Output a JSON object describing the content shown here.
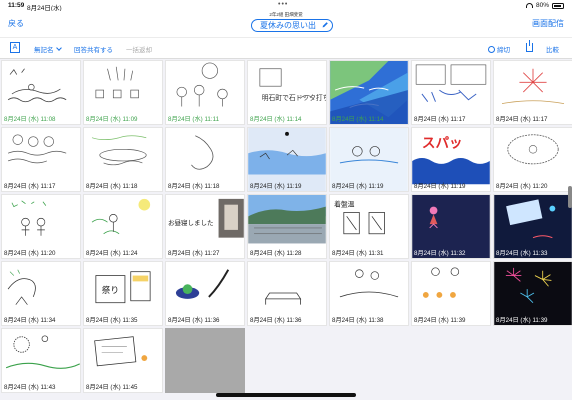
{
  "status": {
    "time": "11:59",
    "date": "8月24日(水)",
    "battery": "80%"
  },
  "nav": {
    "back_label": "戻る",
    "class_label": "2年2組 田畑斐覚",
    "title": "夏休みの思い出",
    "screen_share_label": "画面配信"
  },
  "toolbar": {
    "a_icon": "A",
    "anonymous_label": "無記名",
    "share_answers_label": "回答共有する",
    "bulk_return_label": "一括返却",
    "deadline_label": "締切",
    "compare_label": "比較"
  },
  "icons": {
    "pencil": "pencil-icon",
    "share": "share-icon",
    "clock": "clock-icon",
    "wifi": "wifi-icon",
    "battery": "battery-icon"
  },
  "colors": {
    "accent": "#1a73e8",
    "submitted_green": "#3fa34d",
    "empty_slot": "#a9a9a9"
  },
  "cells": [
    {
      "timestamp": "8月24日 (水) 11:08",
      "green": true
    },
    {
      "timestamp": "8月24日 (水) 11:09",
      "green": true
    },
    {
      "timestamp": "8月24日 (水) 11:11",
      "green": true
    },
    {
      "timestamp": "8月24日 (水) 11:14",
      "green": true,
      "drawing_text": "明石町で石ドック打ちらした"
    },
    {
      "timestamp": "8月24日 (水) 11:14",
      "green": true
    },
    {
      "timestamp": "8月24日 (水) 11:17",
      "green": false
    },
    {
      "timestamp": "8月24日 (水) 11:17",
      "green": false
    },
    {
      "timestamp": "8月24日 (水) 11:17",
      "green": false
    },
    {
      "timestamp": "8月24日 (水) 11:18",
      "green": false
    },
    {
      "timestamp": "8月24日 (水) 11:18",
      "green": false
    },
    {
      "timestamp": "8月24日 (水) 11:19",
      "green": false
    },
    {
      "timestamp": "8月24日 (水) 11:19",
      "green": false
    },
    {
      "timestamp": "8月24日 (水) 11:19",
      "green": false,
      "drawing_text": "スパッ"
    },
    {
      "timestamp": "8月24日 (水) 11:20",
      "green": false
    },
    {
      "timestamp": "8月24日 (水) 11:20",
      "green": false
    },
    {
      "timestamp": "8月24日 (水) 11:24",
      "green": false
    },
    {
      "timestamp": "8月24日 (水) 11:27",
      "green": false,
      "drawing_text": "お昼寝しました"
    },
    {
      "timestamp": "8月24日 (水) 11:28",
      "green": false
    },
    {
      "timestamp": "8月24日 (水) 11:31",
      "green": false,
      "drawing_text": "着盤温"
    },
    {
      "timestamp": "8月24日 (水) 11:32",
      "green": false
    },
    {
      "timestamp": "8月24日 (水) 11:33",
      "green": false
    },
    {
      "timestamp": "8月24日 (水) 11:34",
      "green": false
    },
    {
      "timestamp": "8月24日 (水) 11:35",
      "green": false,
      "drawing_text": "祭り"
    },
    {
      "timestamp": "8月24日 (水) 11:36",
      "green": false
    },
    {
      "timestamp": "8月24日 (水) 11:36",
      "green": false
    },
    {
      "timestamp": "8月24日 (水) 11:38",
      "green": false
    },
    {
      "timestamp": "8月24日 (水) 11:39",
      "green": false
    },
    {
      "timestamp": "8月24日 (水) 11:39",
      "green": false
    },
    {
      "timestamp": "8月24日 (水) 11:43",
      "green": false
    },
    {
      "timestamp": "8月24日 (水) 11:45",
      "green": false
    },
    {
      "timestamp": "",
      "green": false,
      "empty": true
    }
  ]
}
